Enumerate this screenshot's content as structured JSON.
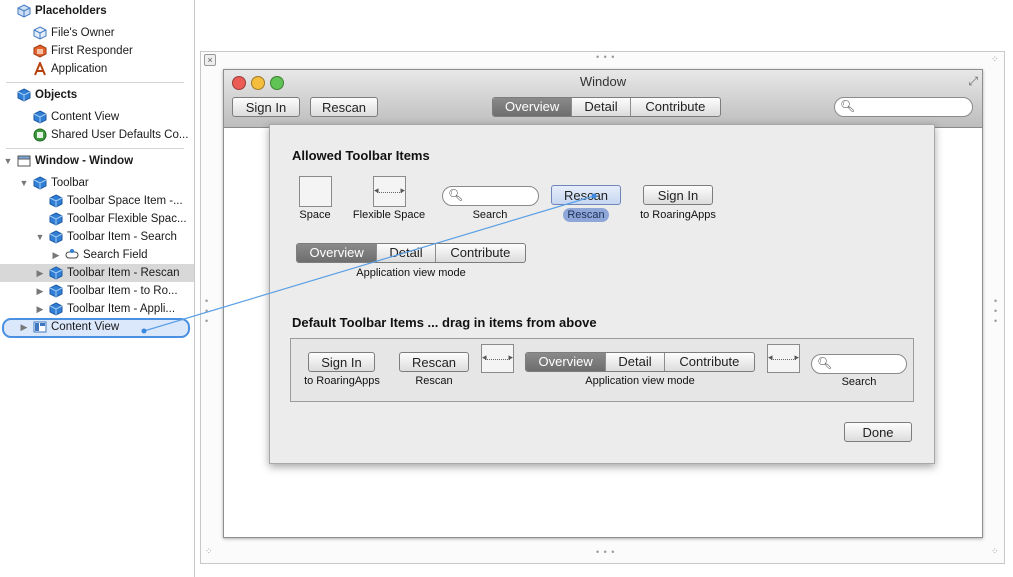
{
  "outline": {
    "placeholders": {
      "label": "Placeholders",
      "items": [
        "File's Owner",
        "First Responder",
        "Application"
      ]
    },
    "objects": {
      "label": "Objects",
      "items": [
        "Content View",
        "Shared User Defaults Co..."
      ]
    },
    "window": {
      "label": "Window - Window",
      "toolbar": "Toolbar",
      "toolbar_children": [
        "Toolbar Space Item -...",
        "Toolbar Flexible Spac...",
        "Toolbar Item - Search"
      ],
      "search_field": "Search Field",
      "toolbar_more": [
        "Toolbar Item - Rescan",
        "Toolbar Item - to Ro...",
        "Toolbar Item - Appli..."
      ],
      "content_view": "Content View"
    }
  },
  "window": {
    "title": "Window",
    "toolbar": {
      "sign_in": "Sign In",
      "rescan": "Rescan",
      "segments": [
        "Overview",
        "Detail",
        "Contribute"
      ],
      "selected_segment": "Overview",
      "search_placeholder": ""
    }
  },
  "sheet": {
    "allowed_heading": "Allowed Toolbar Items",
    "allowed": {
      "space": "Space",
      "flexible_space": "Flexible Space",
      "search": "Search",
      "rescan_button": "Rescan",
      "rescan_caption": "Rescan",
      "sign_in_button": "Sign In",
      "sign_in_caption": "to RoaringApps",
      "segments": [
        "Overview",
        "Detail",
        "Contribute"
      ],
      "segments_caption": "Application view mode"
    },
    "default_heading": "Default Toolbar Items ... drag in items from above",
    "default": {
      "sign_in_button": "Sign In",
      "sign_in_caption": "to RoaringApps",
      "rescan_button": "Rescan",
      "rescan_caption": "Rescan",
      "segments": [
        "Overview",
        "Detail",
        "Contribute"
      ],
      "segments_caption": "Application view mode",
      "search_caption": "Search"
    },
    "done": "Done"
  },
  "colors": {
    "selection_highlight": "#dbe8fb",
    "selection_border": "#4a8fe0",
    "connection_line": "#5aa0e6",
    "segment_selected": "#7a7a7a"
  },
  "icons": {
    "placeholder": "cube-outline-icon",
    "first_responder": "first-responder-icon",
    "application": "application-a-icon",
    "object": "blue-cube-icon",
    "window": "window-icon",
    "search": "magnifier-icon"
  }
}
